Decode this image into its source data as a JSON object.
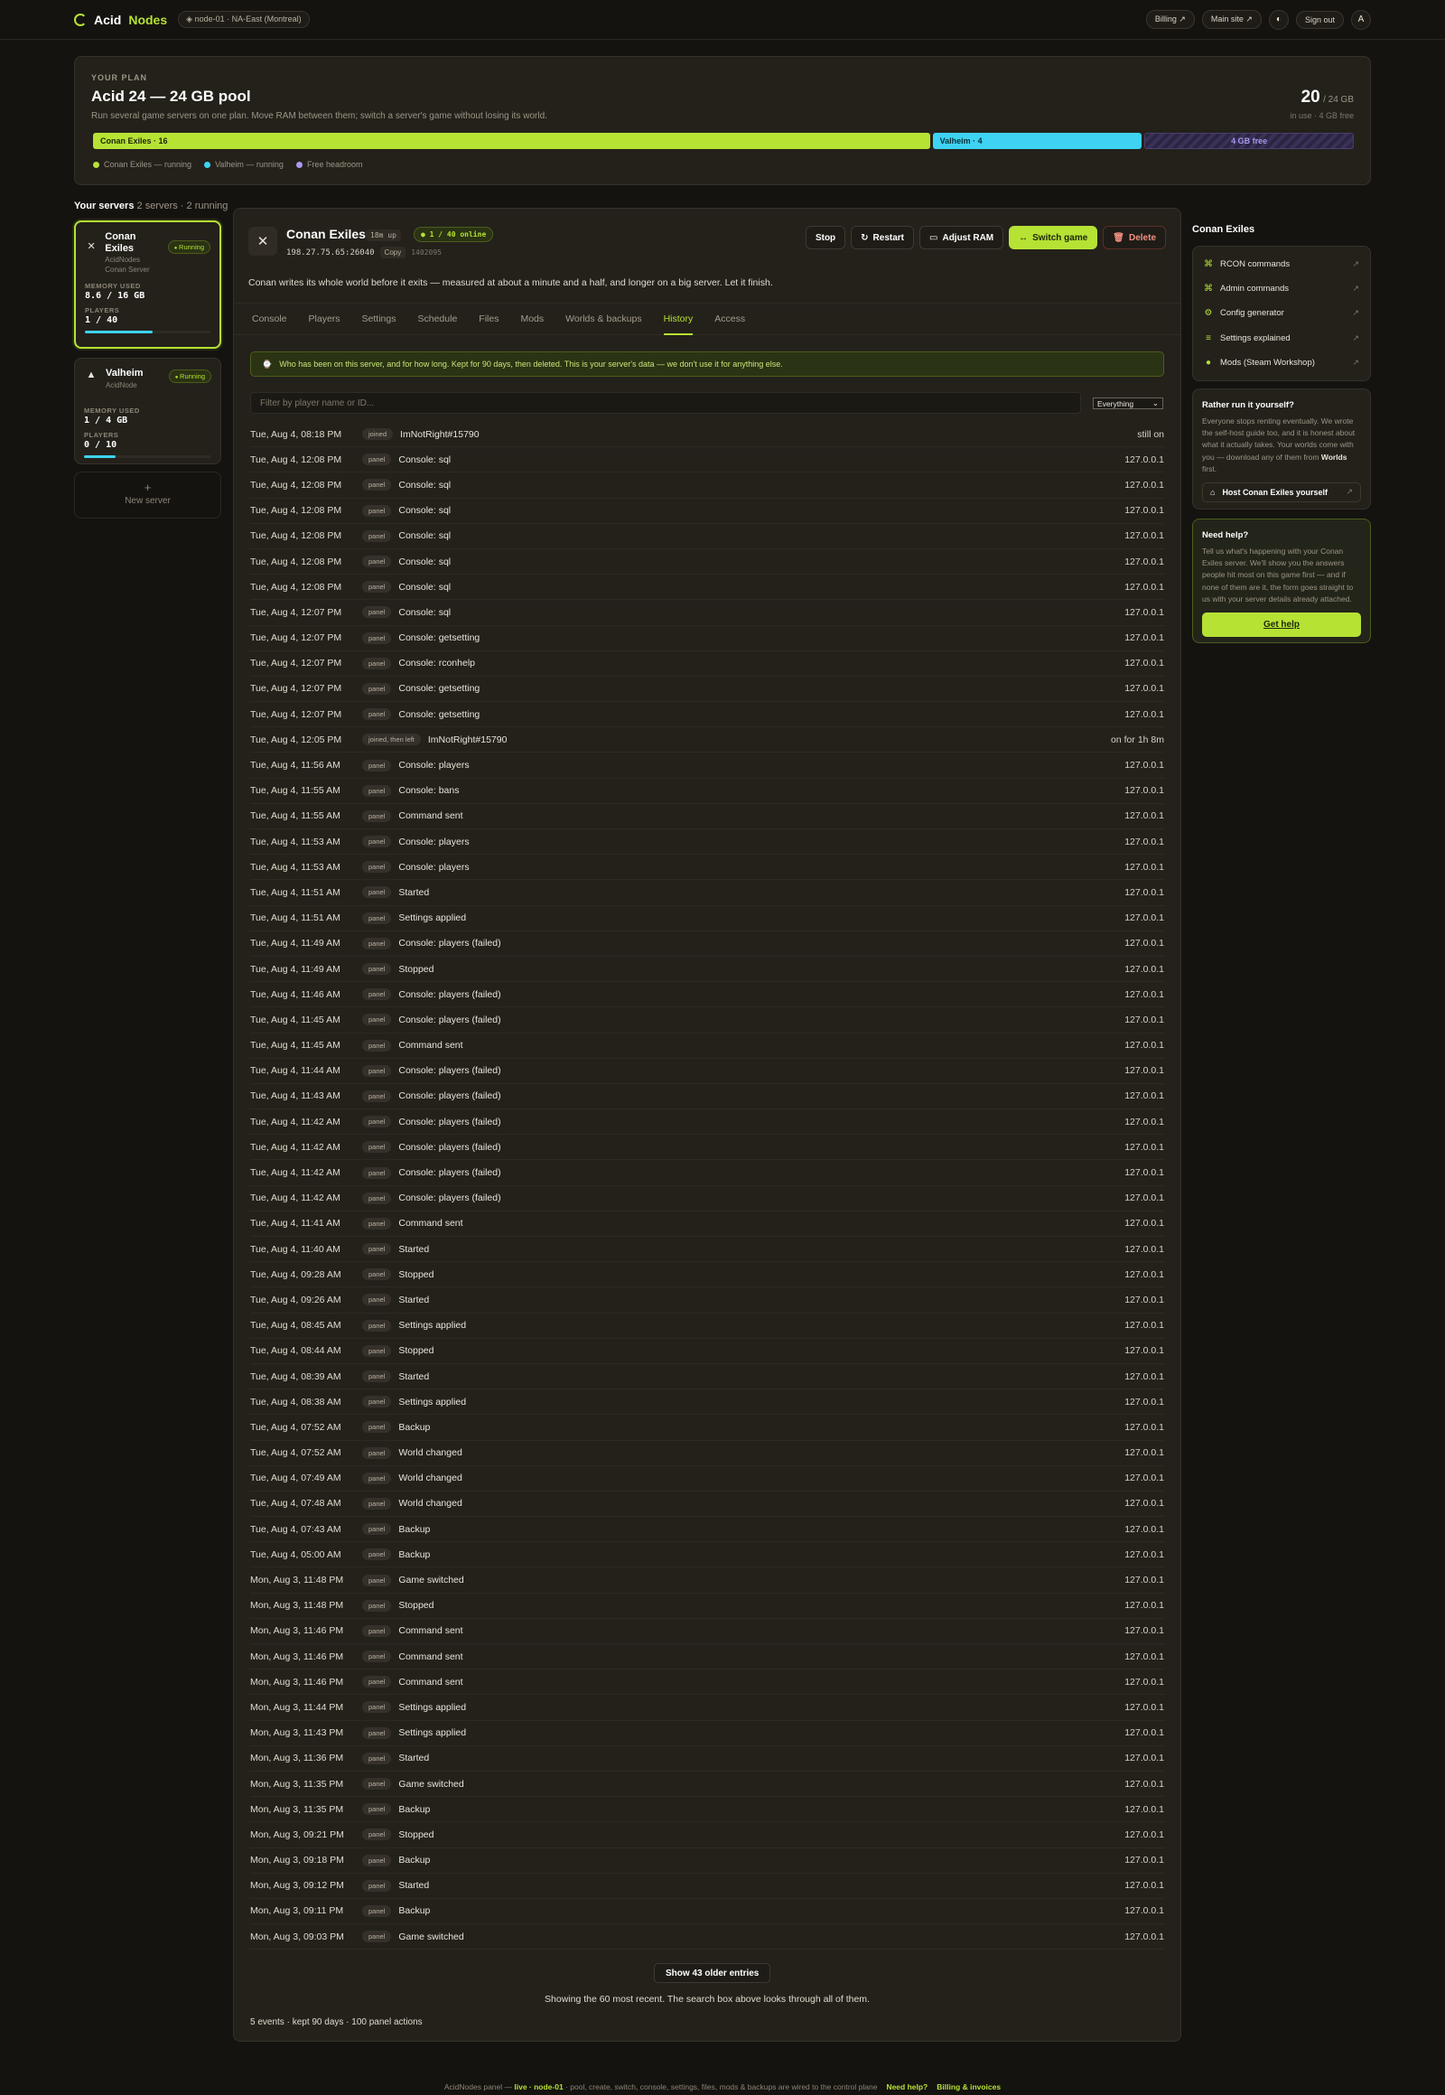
{
  "brand": {
    "name_a": "Acid",
    "name_b": "Nodes",
    "node": "node-01 · NA-East (Montreal)"
  },
  "topnav": {
    "billing": "Billing ↗",
    "main_site": "Main site ↗",
    "theme_icon": "◐",
    "sign_out": "Sign out",
    "avatar": "A"
  },
  "plan": {
    "kicker": "YOUR PLAN",
    "title": "Acid 24 — 24 GB pool",
    "subtitle": "Run several game servers on one plan. Move RAM between them; switch a server's game without losing its world.",
    "used": "20",
    "total": "/ 24 GB",
    "note": "in use · 4 GB free",
    "segments": [
      {
        "label": "Conan Exiles · 16",
        "gb": 16,
        "color": "#b6e234"
      },
      {
        "label": "Valheim · 4",
        "gb": 4,
        "color": "#3ed3f2"
      },
      {
        "label": "4 GB free",
        "gb": 4,
        "color": "#a898f0"
      }
    ],
    "legend": [
      {
        "label": "Conan Exiles — running",
        "color": "#b6e234"
      },
      {
        "label": "Valheim — running",
        "color": "#3ed3f2"
      },
      {
        "label": "Free headroom",
        "color": "#a898f0"
      }
    ]
  },
  "servers": {
    "heading": "Your servers",
    "count": "2 servers · 2 running",
    "list": [
      {
        "name": "Conan Exiles",
        "provider": "AcidNodes",
        "type": "Conan Server",
        "status": "Running",
        "mem_label": "MEMORY USED",
        "mem": "8.6 / 16 GB",
        "players_label": "PLAYERS",
        "players": "1 / 40",
        "fill": 0.54
      },
      {
        "name": "Valheim",
        "provider": "AcidNode",
        "type": "",
        "status": "Running",
        "mem_label": "MEMORY USED",
        "mem": "1 / 4 GB",
        "players_label": "PLAYERS",
        "players": "0 / 10",
        "fill": 0.25
      }
    ],
    "new_server": "New server"
  },
  "main": {
    "title": "Conan Exiles",
    "uptime": "18m up",
    "online": "1 / 40 online",
    "ip": "198.27.75.65:26040",
    "copy": "Copy",
    "app_id": "1402095",
    "actions": {
      "stop": "Stop",
      "restart": "Restart",
      "adjust_ram": "Adjust RAM",
      "switch_game": "Switch game",
      "delete": "Delete"
    },
    "description": "Conan writes its whole world before it exits — measured at about a minute and a half, and longer on a big server. Let it finish.",
    "tabs": [
      "Console",
      "Players",
      "Settings",
      "Schedule",
      "Files",
      "Mods",
      "Worlds & backups",
      "History",
      "Access"
    ],
    "notice": "Who has been on this server, and for how long. Kept for 90 days, then deleted. This is your server's data — we don't use it for anything else.",
    "filter_placeholder": "Filter by player name or ID...",
    "filter_kind": "Everything",
    "more_button": "Show 43 older entries",
    "more_note": "Showing the 60 most recent. The search box above looks through all of them.",
    "summary": "5 events · kept 90 days · 100 panel actions"
  },
  "history": [
    {
      "t": "Tue, Aug 4, 08:18 PM",
      "k": "joined",
      "d": "ImNotRight#15790",
      "r": "still on"
    },
    {
      "t": "Tue, Aug 4, 12:08 PM",
      "k": "panel",
      "d": "Console: sql",
      "r": "127.0.0.1"
    },
    {
      "t": "Tue, Aug 4, 12:08 PM",
      "k": "panel",
      "d": "Console: sql",
      "r": "127.0.0.1"
    },
    {
      "t": "Tue, Aug 4, 12:08 PM",
      "k": "panel",
      "d": "Console: sql",
      "r": "127.0.0.1"
    },
    {
      "t": "Tue, Aug 4, 12:08 PM",
      "k": "panel",
      "d": "Console: sql",
      "r": "127.0.0.1"
    },
    {
      "t": "Tue, Aug 4, 12:08 PM",
      "k": "panel",
      "d": "Console: sql",
      "r": "127.0.0.1"
    },
    {
      "t": "Tue, Aug 4, 12:08 PM",
      "k": "panel",
      "d": "Console: sql",
      "r": "127.0.0.1"
    },
    {
      "t": "Tue, Aug 4, 12:07 PM",
      "k": "panel",
      "d": "Console: sql",
      "r": "127.0.0.1"
    },
    {
      "t": "Tue, Aug 4, 12:07 PM",
      "k": "panel",
      "d": "Console: getsetting",
      "r": "127.0.0.1"
    },
    {
      "t": "Tue, Aug 4, 12:07 PM",
      "k": "panel",
      "d": "Console: rconhelp",
      "r": "127.0.0.1"
    },
    {
      "t": "Tue, Aug 4, 12:07 PM",
      "k": "panel",
      "d": "Console: getsetting",
      "r": "127.0.0.1"
    },
    {
      "t": "Tue, Aug 4, 12:07 PM",
      "k": "panel",
      "d": "Console: getsetting",
      "r": "127.0.0.1"
    },
    {
      "t": "Tue, Aug 4, 12:05 PM",
      "k": "joined, then left",
      "d": "ImNotRight#15790",
      "r": "on for 1h 8m"
    },
    {
      "t": "Tue, Aug 4, 11:56 AM",
      "k": "panel",
      "d": "Console: players",
      "r": "127.0.0.1"
    },
    {
      "t": "Tue, Aug 4, 11:55 AM",
      "k": "panel",
      "d": "Console: bans",
      "r": "127.0.0.1"
    },
    {
      "t": "Tue, Aug 4, 11:55 AM",
      "k": "panel",
      "d": "Command sent",
      "r": "127.0.0.1"
    },
    {
      "t": "Tue, Aug 4, 11:53 AM",
      "k": "panel",
      "d": "Console: players",
      "r": "127.0.0.1"
    },
    {
      "t": "Tue, Aug 4, 11:53 AM",
      "k": "panel",
      "d": "Console: players",
      "r": "127.0.0.1"
    },
    {
      "t": "Tue, Aug 4, 11:51 AM",
      "k": "panel",
      "d": "Started",
      "r": "127.0.0.1"
    },
    {
      "t": "Tue, Aug 4, 11:51 AM",
      "k": "panel",
      "d": "Settings applied",
      "r": "127.0.0.1"
    },
    {
      "t": "Tue, Aug 4, 11:49 AM",
      "k": "panel",
      "d": "Console: players (failed)",
      "r": "127.0.0.1"
    },
    {
      "t": "Tue, Aug 4, 11:49 AM",
      "k": "panel",
      "d": "Stopped",
      "r": "127.0.0.1"
    },
    {
      "t": "Tue, Aug 4, 11:46 AM",
      "k": "panel",
      "d": "Console: players (failed)",
      "r": "127.0.0.1"
    },
    {
      "t": "Tue, Aug 4, 11:45 AM",
      "k": "panel",
      "d": "Console: players (failed)",
      "r": "127.0.0.1"
    },
    {
      "t": "Tue, Aug 4, 11:45 AM",
      "k": "panel",
      "d": "Command sent",
      "r": "127.0.0.1"
    },
    {
      "t": "Tue, Aug 4, 11:44 AM",
      "k": "panel",
      "d": "Console: players (failed)",
      "r": "127.0.0.1"
    },
    {
      "t": "Tue, Aug 4, 11:43 AM",
      "k": "panel",
      "d": "Console: players (failed)",
      "r": "127.0.0.1"
    },
    {
      "t": "Tue, Aug 4, 11:42 AM",
      "k": "panel",
      "d": "Console: players (failed)",
      "r": "127.0.0.1"
    },
    {
      "t": "Tue, Aug 4, 11:42 AM",
      "k": "panel",
      "d": "Console: players (failed)",
      "r": "127.0.0.1"
    },
    {
      "t": "Tue, Aug 4, 11:42 AM",
      "k": "panel",
      "d": "Console: players (failed)",
      "r": "127.0.0.1"
    },
    {
      "t": "Tue, Aug 4, 11:42 AM",
      "k": "panel",
      "d": "Console: players (failed)",
      "r": "127.0.0.1"
    },
    {
      "t": "Tue, Aug 4, 11:41 AM",
      "k": "panel",
      "d": "Command sent",
      "r": "127.0.0.1"
    },
    {
      "t": "Tue, Aug 4, 11:40 AM",
      "k": "panel",
      "d": "Started",
      "r": "127.0.0.1"
    },
    {
      "t": "Tue, Aug 4, 09:28 AM",
      "k": "panel",
      "d": "Stopped",
      "r": "127.0.0.1"
    },
    {
      "t": "Tue, Aug 4, 09:26 AM",
      "k": "panel",
      "d": "Started",
      "r": "127.0.0.1"
    },
    {
      "t": "Tue, Aug 4, 08:45 AM",
      "k": "panel",
      "d": "Settings applied",
      "r": "127.0.0.1"
    },
    {
      "t": "Tue, Aug 4, 08:44 AM",
      "k": "panel",
      "d": "Stopped",
      "r": "127.0.0.1"
    },
    {
      "t": "Tue, Aug 4, 08:39 AM",
      "k": "panel",
      "d": "Started",
      "r": "127.0.0.1"
    },
    {
      "t": "Tue, Aug 4, 08:38 AM",
      "k": "panel",
      "d": "Settings applied",
      "r": "127.0.0.1"
    },
    {
      "t": "Tue, Aug 4, 07:52 AM",
      "k": "panel",
      "d": "Backup",
      "r": "127.0.0.1"
    },
    {
      "t": "Tue, Aug 4, 07:52 AM",
      "k": "panel",
      "d": "World changed",
      "r": "127.0.0.1"
    },
    {
      "t": "Tue, Aug 4, 07:49 AM",
      "k": "panel",
      "d": "World changed",
      "r": "127.0.0.1"
    },
    {
      "t": "Tue, Aug 4, 07:48 AM",
      "k": "panel",
      "d": "World changed",
      "r": "127.0.0.1"
    },
    {
      "t": "Tue, Aug 4, 07:43 AM",
      "k": "panel",
      "d": "Backup",
      "r": "127.0.0.1"
    },
    {
      "t": "Tue, Aug 4, 05:00 AM",
      "k": "panel",
      "d": "Backup",
      "r": "127.0.0.1"
    },
    {
      "t": "Mon, Aug 3, 11:48 PM",
      "k": "panel",
      "d": "Game switched",
      "r": "127.0.0.1"
    },
    {
      "t": "Mon, Aug 3, 11:48 PM",
      "k": "panel",
      "d": "Stopped",
      "r": "127.0.0.1"
    },
    {
      "t": "Mon, Aug 3, 11:46 PM",
      "k": "panel",
      "d": "Command sent",
      "r": "127.0.0.1"
    },
    {
      "t": "Mon, Aug 3, 11:46 PM",
      "k": "panel",
      "d": "Command sent",
      "r": "127.0.0.1"
    },
    {
      "t": "Mon, Aug 3, 11:46 PM",
      "k": "panel",
      "d": "Command sent",
      "r": "127.0.0.1"
    },
    {
      "t": "Mon, Aug 3, 11:44 PM",
      "k": "panel",
      "d": "Settings applied",
      "r": "127.0.0.1"
    },
    {
      "t": "Mon, Aug 3, 11:43 PM",
      "k": "panel",
      "d": "Settings applied",
      "r": "127.0.0.1"
    },
    {
      "t": "Mon, Aug 3, 11:36 PM",
      "k": "panel",
      "d": "Started",
      "r": "127.0.0.1"
    },
    {
      "t": "Mon, Aug 3, 11:35 PM",
      "k": "panel",
      "d": "Game switched",
      "r": "127.0.0.1"
    },
    {
      "t": "Mon, Aug 3, 11:35 PM",
      "k": "panel",
      "d": "Backup",
      "r": "127.0.0.1"
    },
    {
      "t": "Mon, Aug 3, 09:21 PM",
      "k": "panel",
      "d": "Stopped",
      "r": "127.0.0.1"
    },
    {
      "t": "Mon, Aug 3, 09:18 PM",
      "k": "panel",
      "d": "Backup",
      "r": "127.0.0.1"
    },
    {
      "t": "Mon, Aug 3, 09:12 PM",
      "k": "panel",
      "d": "Started",
      "r": "127.0.0.1"
    },
    {
      "t": "Mon, Aug 3, 09:11 PM",
      "k": "panel",
      "d": "Backup",
      "r": "127.0.0.1"
    },
    {
      "t": "Mon, Aug 3, 09:03 PM",
      "k": "panel",
      "d": "Game switched",
      "r": "127.0.0.1"
    }
  ],
  "side": {
    "title": "Conan Exiles",
    "tools": [
      {
        "icon": "⌘",
        "label": "RCON commands"
      },
      {
        "icon": "⌘",
        "label": "Admin commands"
      },
      {
        "icon": "⚙",
        "label": "Config generator"
      },
      {
        "icon": "≡",
        "label": "Settings explained"
      },
      {
        "icon": "●",
        "label": "Mods (Steam Workshop)"
      }
    ],
    "selfhost_title": "Rather run it yourself?",
    "selfhost_text_a": "Everyone stops renting eventually. We wrote the self-host guide too, and it is honest about what it actually takes. Your worlds come with you — download any of them from ",
    "selfhost_text_b": "Worlds",
    "selfhost_text_c": " first.",
    "selfhost_button": "Host Conan Exiles yourself",
    "help_title": "Need help?",
    "help_text": "Tell us what's happening with your Conan Exiles server. We'll show you the answers people hit most on this game first — and if none of them are it, the form goes straight to us with your server details already attached.",
    "help_button": "Get help"
  },
  "footer": {
    "prefix": "AcidNodes panel — ",
    "live": "live · node-01",
    "rest": " · pool, create, switch, console, settings, files, mods & backups are wired to the control plane",
    "help": "Need help?",
    "billing": "Billing & invoices"
  }
}
